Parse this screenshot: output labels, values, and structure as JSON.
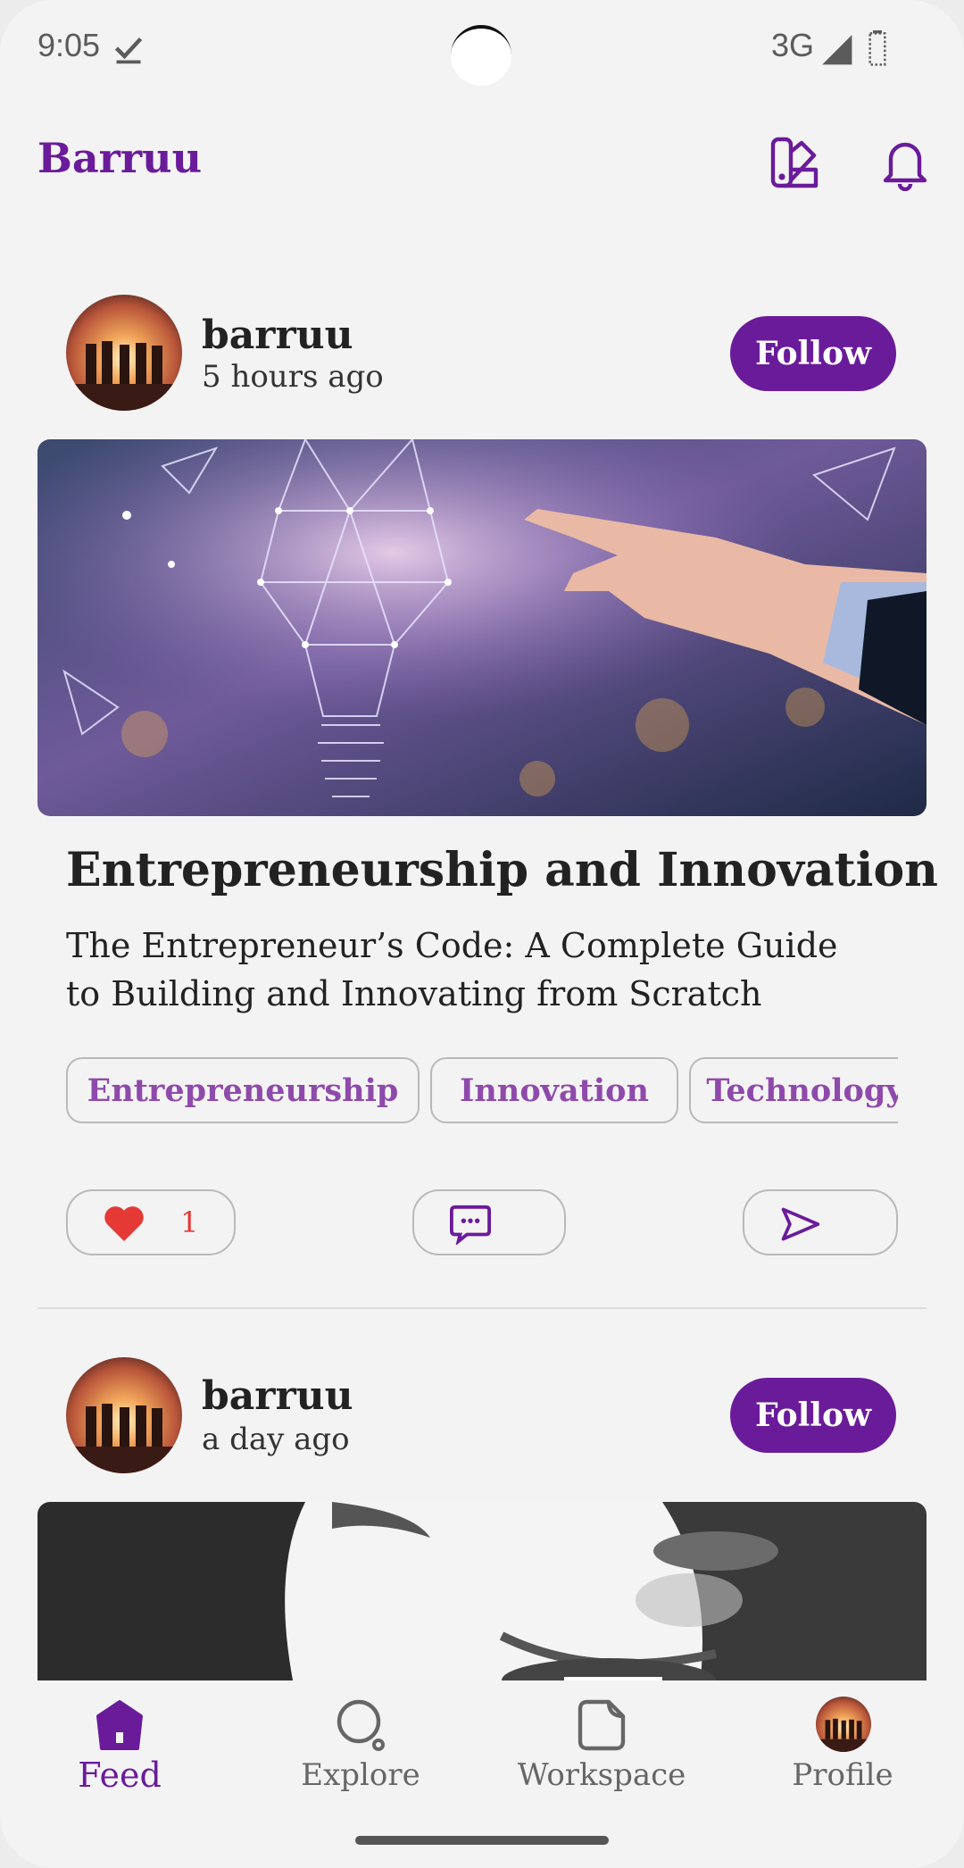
{
  "status_bar": {
    "time": "9:05",
    "network": "3G"
  },
  "header": {
    "title": "Barruu",
    "icons": [
      "palette-icon",
      "bell-icon"
    ]
  },
  "posts": [
    {
      "author": "barruu",
      "timestamp": "5 hours ago",
      "follow_label": "Follow",
      "title": "Entrepreneurship and Innovation",
      "subtitle": "The Entrepreneur’s Code: A Complete Guide to Building and Innovating from Scratch",
      "tags": [
        "Entrepreneurship",
        "Innovation",
        "Technology"
      ],
      "likes": "1"
    },
    {
      "author": "barruu",
      "timestamp": "a day ago",
      "follow_label": "Follow"
    }
  ],
  "bottom_nav": {
    "items": [
      {
        "label": "Feed",
        "icon": "home-icon",
        "active": true
      },
      {
        "label": "Explore",
        "icon": "search-icon",
        "active": false
      },
      {
        "label": "Workspace",
        "icon": "document-icon",
        "active": false
      },
      {
        "label": "Profile",
        "icon": "avatar",
        "active": false
      }
    ]
  },
  "colors": {
    "accent": "#6a1b9a",
    "tag_text": "#8e4aab",
    "like": "#e53935",
    "background": "#f4f3f4"
  }
}
